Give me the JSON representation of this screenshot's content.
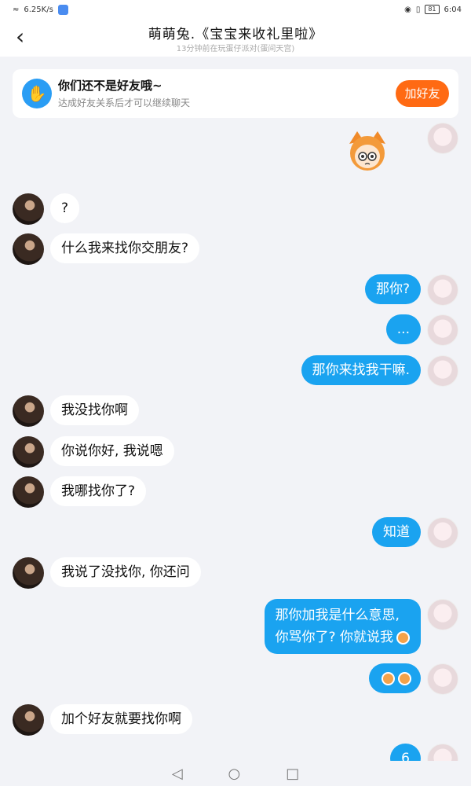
{
  "status_bar": {
    "net_speed": "6.25K/s",
    "battery": "81",
    "time": "6:04"
  },
  "header": {
    "back_icon": "chevron-left-icon",
    "title": "萌萌兔.《宝宝来收礼里啦》",
    "subtitle": "13分钟前在玩蛋仔派对(蛋间天宫)"
  },
  "banner": {
    "title": "你们还不是好友哦~",
    "subtitle": "达成好友关系后才可以继续聊天",
    "button": "加好友",
    "icon": "wave-hand-icon"
  },
  "messages": [
    {
      "sender": "me",
      "type": "sticker"
    },
    {
      "sender": "them",
      "text": "?"
    },
    {
      "sender": "them",
      "text": "什么我来找你交朋友?"
    },
    {
      "sender": "me",
      "text": "那你?"
    },
    {
      "sender": "me",
      "text": "..."
    },
    {
      "sender": "me",
      "text": "那你来找我干嘛."
    },
    {
      "sender": "them",
      "text": "我没找你啊"
    },
    {
      "sender": "them",
      "text": "你说你好, 我说嗯"
    },
    {
      "sender": "them",
      "text": "我哪找你了?"
    },
    {
      "sender": "me",
      "text": "知道"
    },
    {
      "sender": "them",
      "text": "我说了没找你, 你还问"
    },
    {
      "sender": "me",
      "line1": "那你加我是什么意思,",
      "line2": "你骂你了? 你就说我"
    },
    {
      "sender": "me",
      "type": "emoji"
    },
    {
      "sender": "them",
      "text": "加个好友就要找你啊"
    },
    {
      "sender": "me",
      "text": "6"
    }
  ],
  "colors": {
    "accent": "#1aa3f0",
    "add_button": "#ff6a13",
    "background": "#f2f3f7"
  },
  "nav": {
    "back": "◁",
    "home": "○",
    "recent": "□"
  }
}
